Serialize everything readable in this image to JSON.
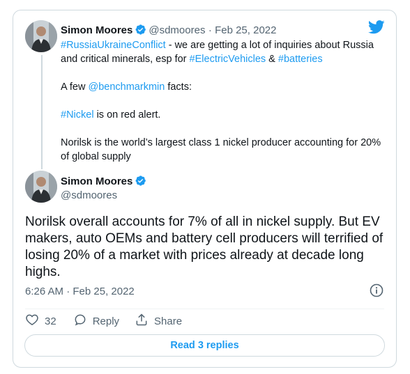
{
  "parent_tweet": {
    "author_name": "Simon Moores",
    "author_handle": "@sdmoores",
    "date_sep": "· Feb 25, 2022",
    "line1_tag": "#RussiaUkraineConflict",
    "line1_text": " - we are getting a lot of inquiries about Russia and critical minerals, esp for ",
    "line1_tag2": "#ElectricVehicles",
    "line1_amp": " & ",
    "line1_tag3": "#batteries",
    "line2_pre": "A few ",
    "line2_mention": "@benchmarkmin",
    "line2_post": " facts:",
    "line3_tag": "#Nickel",
    "line3_text": " is on red alert.",
    "line4_text": "Norilsk is the world’s largest class 1 nickel producer accounting for 20% of global supply"
  },
  "main_tweet": {
    "author_name": "Simon Moores",
    "author_handle": "@sdmoores",
    "text": "Norilsk overall accounts for 7% of all in nickel supply. But EV makers, auto OEMs and battery cell producers will terrified of losing 20% of a market with prices already at decade long highs.",
    "timestamp": "6:26 AM · Feb 25, 2022"
  },
  "actions": {
    "like_count": "32",
    "reply_label": "Reply",
    "share_label": "Share"
  },
  "read_replies_label": "Read 3 replies",
  "icons": {
    "brand": "twitter-bird-icon",
    "verified": "verified-badge-icon",
    "like": "heart-icon",
    "reply": "speech-bubble-icon",
    "share": "share-icon",
    "info": "info-icon"
  },
  "colors": {
    "accent": "#1d9bf0",
    "text": "#0f1419",
    "muted": "#536471",
    "border": "#cfd9de"
  }
}
